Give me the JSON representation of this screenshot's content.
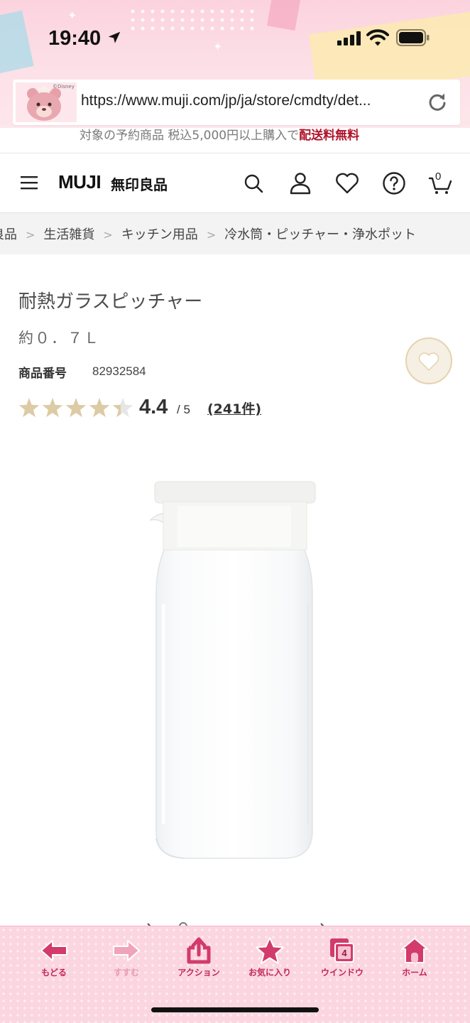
{
  "status_bar": {
    "time": "19:40"
  },
  "browser": {
    "url": "https://www.muji.com/jp/ja/store/cmdty/det...",
    "avatar_caption": "©Disney"
  },
  "promo": {
    "text_prefix": "対象の予約商品 税込5,000円以上購入で",
    "text_highlight": "配送料無料"
  },
  "header": {
    "logo": "MUJI",
    "logo_sub": "無印良品",
    "cart_count": "0"
  },
  "breadcrumb": [
    "良品",
    "生活雑貨",
    "キッチン用品",
    "冷水筒・ピッチャー・浄水ポット"
  ],
  "product": {
    "title": "耐熱ガラスピッチャー",
    "capacity": "約０．７Ｌ",
    "number_label": "商品番号",
    "number": "82932584",
    "rating": "4.4",
    "rating_max": "/ 5",
    "rating_value": 4.4,
    "reviews": "(241件)"
  },
  "colors": {
    "star_filled": "#dccba5",
    "star_empty": "#e6e6e6",
    "accent_pink": "#c2285a"
  },
  "toolbar": [
    {
      "label": "もどる",
      "icon": "back-arrow-icon",
      "enabled": true
    },
    {
      "label": "すすむ",
      "icon": "forward-arrow-icon",
      "enabled": false
    },
    {
      "label": "アクション",
      "icon": "share-icon",
      "enabled": true
    },
    {
      "label": "お気に入り",
      "icon": "star-icon",
      "enabled": true
    },
    {
      "label": "ウインドウ",
      "icon": "windows-icon",
      "enabled": true,
      "badge": "4"
    },
    {
      "label": "ホーム",
      "icon": "home-icon",
      "enabled": true
    }
  ]
}
